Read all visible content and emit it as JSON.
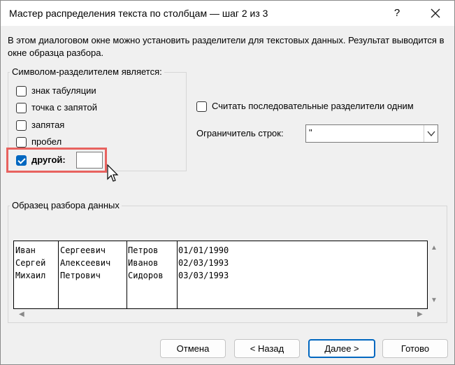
{
  "window": {
    "title": "Мастер распределения текста по столбцам — шаг 2 из 3",
    "help": "?",
    "close": "close-icon"
  },
  "intro_text": "В этом диалоговом окне можно установить разделители для текстовых данных. Результат выводится в окне образца разбора.",
  "delimiters": {
    "legend": "Символом-разделителем является:",
    "options": [
      {
        "label": "знак табуляции",
        "checked": false
      },
      {
        "label": "точка с запятой",
        "checked": false
      },
      {
        "label": "запятая",
        "checked": false
      },
      {
        "label": "пробел",
        "checked": false
      },
      {
        "label": "другой:",
        "checked": true
      }
    ],
    "other_value": ""
  },
  "consecutive": {
    "label": "Считать последовательные разделители одним",
    "checked": false
  },
  "text_qualifier": {
    "label": "Ограничитель строк:",
    "value": "\""
  },
  "preview": {
    "legend": "Образец разбора данных",
    "rows": [
      [
        "Иван",
        "Сергеевич",
        "Петров",
        "01/01/1990"
      ],
      [
        "Сергей",
        "Алексеевич",
        "Иванов",
        "02/03/1993"
      ],
      [
        "Михаил",
        "Петрович",
        "Сидоров",
        "03/03/1993"
      ]
    ]
  },
  "buttons": {
    "cancel": "Отмена",
    "back": "< Назад",
    "next": "Далее >",
    "finish": "Готово"
  },
  "colors": {
    "accent": "#0067c0",
    "highlight": "#e8625f"
  }
}
